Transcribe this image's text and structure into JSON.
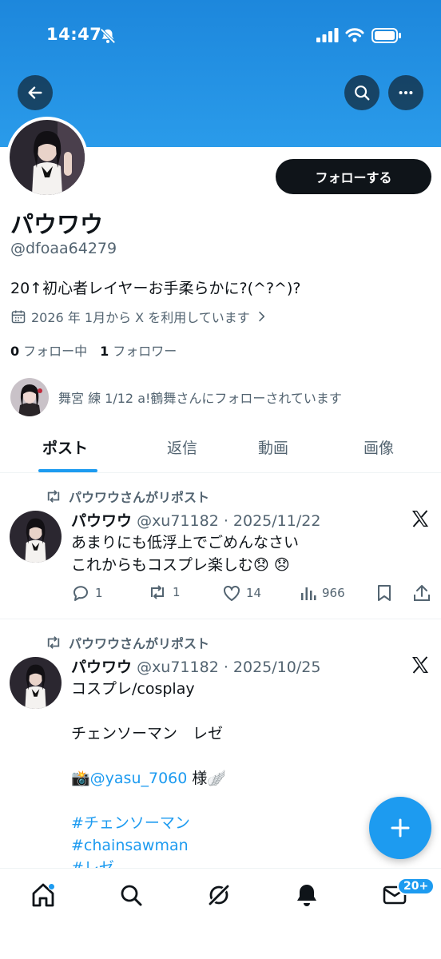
{
  "status_bar": {
    "time": "14:47"
  },
  "profile": {
    "follow_label": "フォローする",
    "name": "パウワウ",
    "handle": "@dfoaa64279",
    "bio": "20↑初心者レイヤーお手柔らかに?(^?^)?",
    "joined": "2026 年 1月から X を利用しています",
    "following_count": "0",
    "following_label": "フォロー中",
    "followers_count": "1",
    "followers_label": "フォロワー",
    "followed_by": "舞宮 練 1/12 a!鶴舞さんにフォローされています"
  },
  "tabs": [
    "ポスト",
    "返信",
    "動画",
    "画像"
  ],
  "posts": [
    {
      "repost_label": "パウワウさんがリポスト",
      "name": "パウワウ",
      "meta": "@xu71182 · 2025/11/22",
      "lines": [
        "あまりにも低浮上でごめんなさい",
        "これからもコスプレ楽しむ😞 😞"
      ],
      "replies": "1",
      "reposts": "1",
      "likes": "14",
      "views": "966"
    },
    {
      "repost_label": "パウワウさんがリポスト",
      "name": "パウワウ",
      "meta": "@xu71182 · 2025/10/25",
      "line1": "コスプレ/cosplay",
      "line2": "チェンソーマン　レゼ",
      "camera": "📸",
      "mention": "@yasu_7060",
      "mention_suffix": " 様🪽",
      "hashtag1": "#チェンソーマン",
      "hashtag2": "#chainsawman",
      "hashtag3": "#レゼ"
    }
  ],
  "bottom_nav": {
    "messages_badge": "20+"
  },
  "colors": {
    "accent": "#1d9bf0",
    "banner": "#2a9bea",
    "text": "#0f1419",
    "secondary": "#536471"
  },
  "icons": [
    "back-arrow-icon",
    "search-icon",
    "more-icon",
    "calendar-icon",
    "chevron-right-icon",
    "repost-icon",
    "x-logo-icon",
    "reply-icon",
    "like-icon",
    "views-icon",
    "bookmark-icon",
    "share-icon",
    "compose-plus-icon",
    "home-icon",
    "explore-icon",
    "grok-icon",
    "notifications-icon",
    "messages-icon"
  ]
}
